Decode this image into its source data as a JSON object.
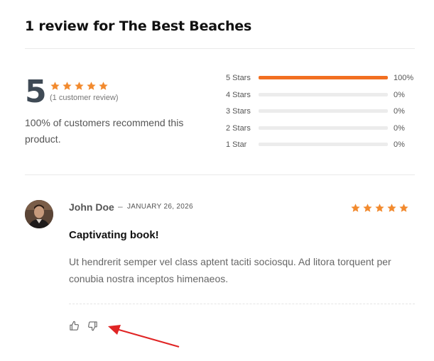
{
  "heading": "1 review for The Best Beaches",
  "summary": {
    "average": "5",
    "stars": 5,
    "count_text": "(1 customer review)",
    "recommend_text": "100% of customers recommend this product."
  },
  "breakdown": [
    {
      "label": "5 Stars",
      "fraction": 1.0,
      "pct": "100%"
    },
    {
      "label": "4 Stars",
      "fraction": 0.0,
      "pct": "0%"
    },
    {
      "label": "3 Stars",
      "fraction": 0.0,
      "pct": "0%"
    },
    {
      "label": "2 Stars",
      "fraction": 0.0,
      "pct": "0%"
    },
    {
      "label": "1 Star",
      "fraction": 0.0,
      "pct": "0%"
    }
  ],
  "review": {
    "author": "John Doe",
    "separator": "–",
    "date": "JANUARY 26, 2026",
    "rating": 5,
    "title": "Captivating book!",
    "body": "Ut hendrerit semper vel class aptent taciti sociosqu. Ad litora torquent per conubia nostra inceptos himenaeos.",
    "actions": {
      "like_icon": "thumbs-up-icon",
      "dislike_icon": "thumbs-down-icon"
    }
  },
  "colors": {
    "star": "#f28a2e",
    "bar": "#f26f21",
    "annotation_arrow": "#e02424"
  }
}
